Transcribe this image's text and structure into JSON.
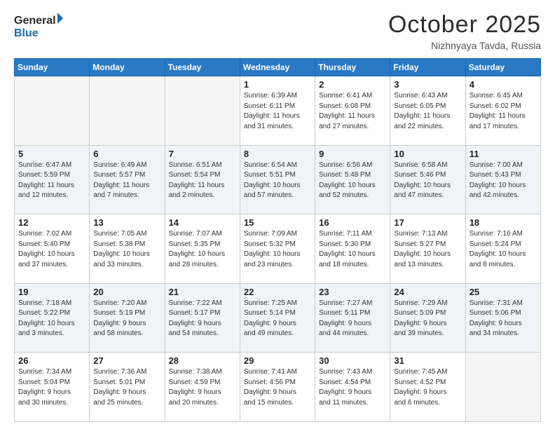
{
  "header": {
    "logo_line1": "General",
    "logo_line2": "Blue",
    "month": "October 2025",
    "location": "Nizhnyaya Tavda, Russia"
  },
  "days_of_week": [
    "Sunday",
    "Monday",
    "Tuesday",
    "Wednesday",
    "Thursday",
    "Friday",
    "Saturday"
  ],
  "weeks": [
    [
      {
        "day": "",
        "info": ""
      },
      {
        "day": "",
        "info": ""
      },
      {
        "day": "",
        "info": ""
      },
      {
        "day": "1",
        "info": "Sunrise: 6:39 AM\nSunset: 6:11 PM\nDaylight: 11 hours\nand 31 minutes."
      },
      {
        "day": "2",
        "info": "Sunrise: 6:41 AM\nSunset: 6:08 PM\nDaylight: 11 hours\nand 27 minutes."
      },
      {
        "day": "3",
        "info": "Sunrise: 6:43 AM\nSunset: 6:05 PM\nDaylight: 11 hours\nand 22 minutes."
      },
      {
        "day": "4",
        "info": "Sunrise: 6:45 AM\nSunset: 6:02 PM\nDaylight: 11 hours\nand 17 minutes."
      }
    ],
    [
      {
        "day": "5",
        "info": "Sunrise: 6:47 AM\nSunset: 5:59 PM\nDaylight: 11 hours\nand 12 minutes."
      },
      {
        "day": "6",
        "info": "Sunrise: 6:49 AM\nSunset: 5:57 PM\nDaylight: 11 hours\nand 7 minutes."
      },
      {
        "day": "7",
        "info": "Sunrise: 6:51 AM\nSunset: 5:54 PM\nDaylight: 11 hours\nand 2 minutes."
      },
      {
        "day": "8",
        "info": "Sunrise: 6:54 AM\nSunset: 5:51 PM\nDaylight: 10 hours\nand 57 minutes."
      },
      {
        "day": "9",
        "info": "Sunrise: 6:56 AM\nSunset: 5:48 PM\nDaylight: 10 hours\nand 52 minutes."
      },
      {
        "day": "10",
        "info": "Sunrise: 6:58 AM\nSunset: 5:46 PM\nDaylight: 10 hours\nand 47 minutes."
      },
      {
        "day": "11",
        "info": "Sunrise: 7:00 AM\nSunset: 5:43 PM\nDaylight: 10 hours\nand 42 minutes."
      }
    ],
    [
      {
        "day": "12",
        "info": "Sunrise: 7:02 AM\nSunset: 5:40 PM\nDaylight: 10 hours\nand 37 minutes."
      },
      {
        "day": "13",
        "info": "Sunrise: 7:05 AM\nSunset: 5:38 PM\nDaylight: 10 hours\nand 33 minutes."
      },
      {
        "day": "14",
        "info": "Sunrise: 7:07 AM\nSunset: 5:35 PM\nDaylight: 10 hours\nand 28 minutes."
      },
      {
        "day": "15",
        "info": "Sunrise: 7:09 AM\nSunset: 5:32 PM\nDaylight: 10 hours\nand 23 minutes."
      },
      {
        "day": "16",
        "info": "Sunrise: 7:11 AM\nSunset: 5:30 PM\nDaylight: 10 hours\nand 18 minutes."
      },
      {
        "day": "17",
        "info": "Sunrise: 7:13 AM\nSunset: 5:27 PM\nDaylight: 10 hours\nand 13 minutes."
      },
      {
        "day": "18",
        "info": "Sunrise: 7:16 AM\nSunset: 5:24 PM\nDaylight: 10 hours\nand 8 minutes."
      }
    ],
    [
      {
        "day": "19",
        "info": "Sunrise: 7:18 AM\nSunset: 5:22 PM\nDaylight: 10 hours\nand 3 minutes."
      },
      {
        "day": "20",
        "info": "Sunrise: 7:20 AM\nSunset: 5:19 PM\nDaylight: 9 hours\nand 58 minutes."
      },
      {
        "day": "21",
        "info": "Sunrise: 7:22 AM\nSunset: 5:17 PM\nDaylight: 9 hours\nand 54 minutes."
      },
      {
        "day": "22",
        "info": "Sunrise: 7:25 AM\nSunset: 5:14 PM\nDaylight: 9 hours\nand 49 minutes."
      },
      {
        "day": "23",
        "info": "Sunrise: 7:27 AM\nSunset: 5:11 PM\nDaylight: 9 hours\nand 44 minutes."
      },
      {
        "day": "24",
        "info": "Sunrise: 7:29 AM\nSunset: 5:09 PM\nDaylight: 9 hours\nand 39 minutes."
      },
      {
        "day": "25",
        "info": "Sunrise: 7:31 AM\nSunset: 5:06 PM\nDaylight: 9 hours\nand 34 minutes."
      }
    ],
    [
      {
        "day": "26",
        "info": "Sunrise: 7:34 AM\nSunset: 5:04 PM\nDaylight: 9 hours\nand 30 minutes."
      },
      {
        "day": "27",
        "info": "Sunrise: 7:36 AM\nSunset: 5:01 PM\nDaylight: 9 hours\nand 25 minutes."
      },
      {
        "day": "28",
        "info": "Sunrise: 7:38 AM\nSunset: 4:59 PM\nDaylight: 9 hours\nand 20 minutes."
      },
      {
        "day": "29",
        "info": "Sunrise: 7:41 AM\nSunset: 4:56 PM\nDaylight: 9 hours\nand 15 minutes."
      },
      {
        "day": "30",
        "info": "Sunrise: 7:43 AM\nSunset: 4:54 PM\nDaylight: 9 hours\nand 11 minutes."
      },
      {
        "day": "31",
        "info": "Sunrise: 7:45 AM\nSunset: 4:52 PM\nDaylight: 9 hours\nand 6 minutes."
      },
      {
        "day": "",
        "info": ""
      }
    ]
  ]
}
